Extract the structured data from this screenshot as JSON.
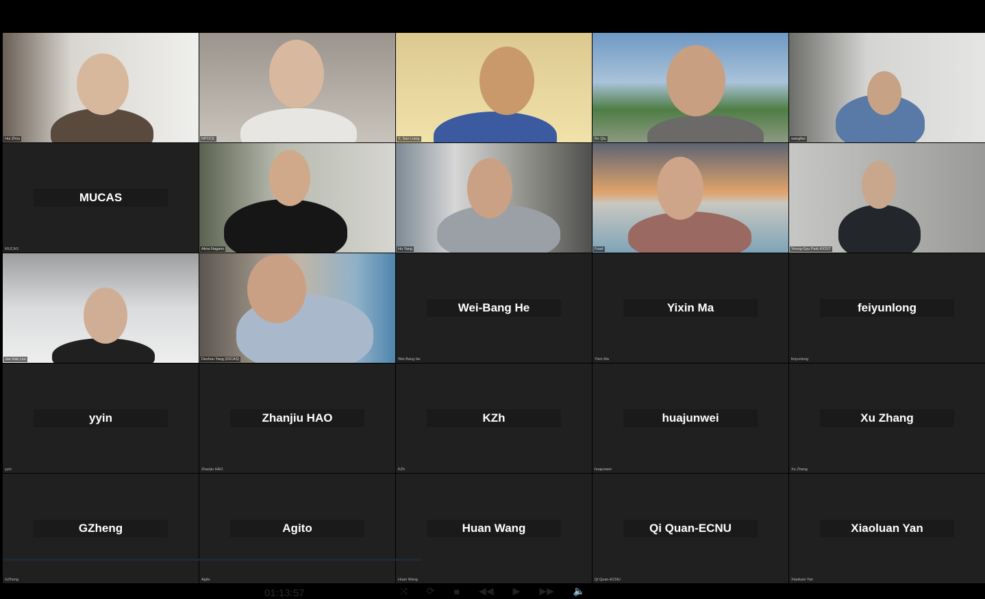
{
  "participants": [
    {
      "name": "Hui Zhou"
    },
    {
      "name": "NPOCE"
    },
    {
      "name": "X. San Liang"
    },
    {
      "name": "Bo Qiu"
    },
    {
      "name": "wangfan"
    },
    {
      "name": "MUCAS",
      "display": "MUCAS"
    },
    {
      "name": "Akira Nagano"
    },
    {
      "name": "Hu Yang"
    },
    {
      "name": "Fuad"
    },
    {
      "name": "Young-Gyu Park KIOST"
    },
    {
      "name": "Jae Hak Lee"
    },
    {
      "name": "Dezhou Yang (IOCAS)"
    },
    {
      "name": "Wei-Bang He",
      "display": "Wei-Bang He"
    },
    {
      "name": "Yixin Ma",
      "display": "Yixin Ma"
    },
    {
      "name": "feiyunlong",
      "display": "feiyunlong"
    },
    {
      "name": "yyin",
      "display": "yyin"
    },
    {
      "name": "Zhanjiu HAO",
      "display": "Zhanjiu HAO"
    },
    {
      "name": "KZh",
      "display": "KZh"
    },
    {
      "name": "huajunwei",
      "display": "huajunwei"
    },
    {
      "name": "Xu Zhang",
      "display": "Xu Zhang"
    },
    {
      "name": "GZheng",
      "display": "GZheng"
    },
    {
      "name": "Agito",
      "display": "Agito"
    },
    {
      "name": "Huan Wang",
      "display": "Huan Wang"
    },
    {
      "name": "Qi Quan-ECNU",
      "display": "Qi Quan-ECNU"
    },
    {
      "name": "Xiaoluan Yan",
      "display": "Xiaoluan Yan"
    }
  ],
  "player": {
    "elapsed": "01:13:57"
  }
}
